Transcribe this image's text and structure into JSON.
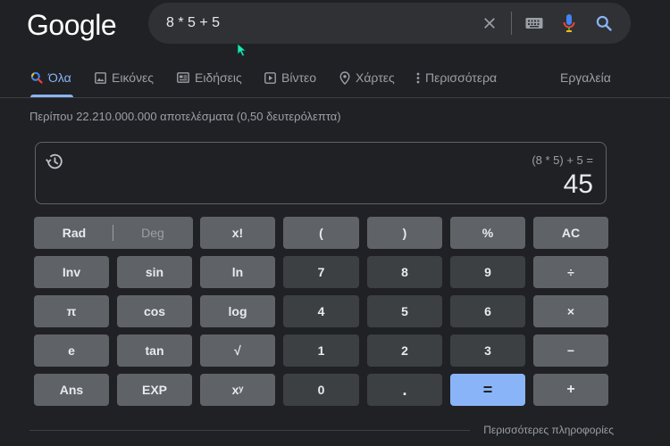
{
  "logo": "Google",
  "search": {
    "query": "8 * 5 + 5"
  },
  "tabs": [
    {
      "label": "Όλα"
    },
    {
      "label": "Εικόνες"
    },
    {
      "label": "Ειδήσεις"
    },
    {
      "label": "Βίντεο"
    },
    {
      "label": "Χάρτες"
    },
    {
      "label": "Περισσότερα"
    }
  ],
  "tools": "Εργαλεία",
  "result_stats": "Περίπου 22.210.000.000 αποτελέσματα (0,50 δευτερόλεπτα)",
  "calculator": {
    "expression": "(8 * 5) + 5 =",
    "result": "45",
    "keys": {
      "rad": "Rad",
      "deg": "Deg",
      "fact": "x!",
      "lparen": "(",
      "rparen": ")",
      "percent": "%",
      "ac": "AC",
      "inv": "Inv",
      "sin": "sin",
      "ln": "ln",
      "k7": "7",
      "k8": "8",
      "k9": "9",
      "div": "÷",
      "pi": "π",
      "cos": "cos",
      "log": "log",
      "k4": "4",
      "k5": "5",
      "k6": "6",
      "mul": "×",
      "e": "e",
      "tan": "tan",
      "sqrt": "√",
      "k1": "1",
      "k2": "2",
      "k3": "3",
      "minus": "−",
      "ans": "Ans",
      "exp": "EXP",
      "pow": "xʸ",
      "k0": "0",
      "dot": ".",
      "eq": "=",
      "plus": "+"
    }
  },
  "more_info": "Περισσότερες πληροφορίες",
  "colors": {
    "background": "#202124",
    "accent": "#8ab4f8",
    "function_key": "#5f6368",
    "number_key": "#3c4043"
  },
  "icons": [
    "clear-icon",
    "keyboard-icon",
    "mic-icon",
    "search-icon",
    "history-icon",
    "images-icon",
    "news-icon",
    "video-icon",
    "maps-icon",
    "more-dots-icon"
  ]
}
